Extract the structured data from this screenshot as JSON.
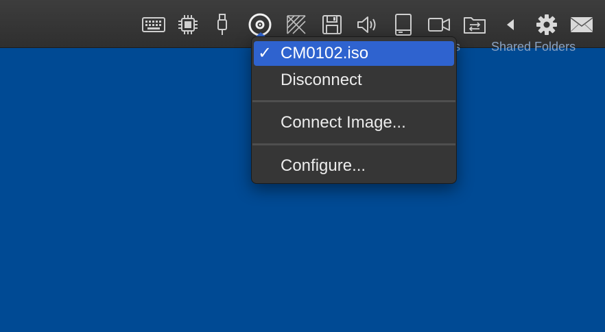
{
  "toolbar": {
    "icons": [
      {
        "name": "keyboard-icon"
      },
      {
        "name": "cpu-icon"
      },
      {
        "name": "usb-icon"
      },
      {
        "name": "cd-dvd-icon"
      },
      {
        "name": "network-icon"
      },
      {
        "name": "floppy-disk-icon"
      },
      {
        "name": "sound-icon"
      },
      {
        "name": "hard-disk-icon"
      },
      {
        "name": "camera-icon"
      },
      {
        "name": "shared-folder-icon"
      },
      {
        "name": "back-arrow-icon"
      },
      {
        "name": "settings-gear-icon"
      },
      {
        "name": "mail-icon"
      }
    ]
  },
  "background_text": {
    "left_fragment": "s",
    "shared_folders": "Shared Folders"
  },
  "menu": {
    "selected_check": "✓",
    "items": [
      {
        "label": "CM0102.iso",
        "checked": true
      },
      {
        "label": "Disconnect"
      },
      {
        "label": "Connect Image..."
      },
      {
        "label": "Configure..."
      }
    ]
  },
  "colors": {
    "desktop_blue": "#004a94",
    "toolbar_gray": "#3a3a3a",
    "menu_bg": "#363636",
    "highlight": "#2f63cf"
  }
}
